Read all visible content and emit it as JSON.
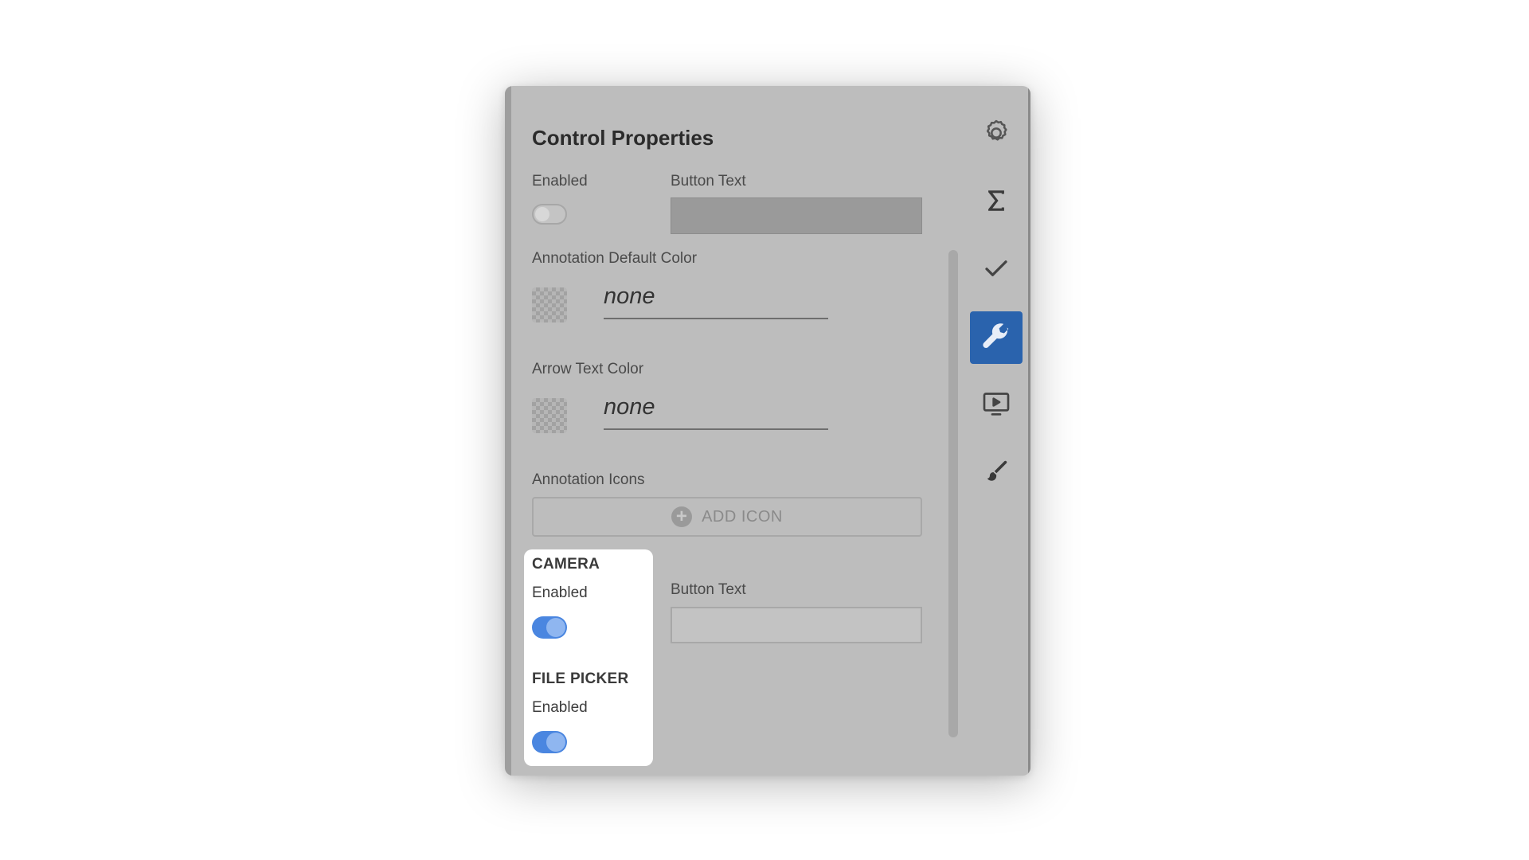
{
  "panel": {
    "title": "Control Properties",
    "enabled_label": "Enabled",
    "button_text_label": "Button Text",
    "annotation_default_color": {
      "label": "Annotation Default Color",
      "value": "none"
    },
    "arrow_text_color": {
      "label": "Arrow Text Color",
      "value": "none"
    },
    "annotation_icons_label": "Annotation Icons",
    "add_icon_label": "ADD ICON",
    "camera": {
      "heading": "CAMERA",
      "enabled_label": "Enabled",
      "enabled": true,
      "button_text_label": "Button Text"
    },
    "file_picker": {
      "heading": "FILE PICKER",
      "enabled_label": "Enabled",
      "enabled": true
    }
  },
  "nav": {
    "items": [
      {
        "icon": "gear-icon",
        "active": false
      },
      {
        "icon": "sigma-icon",
        "active": false
      },
      {
        "icon": "check-icon",
        "active": false
      },
      {
        "icon": "wrench-icon",
        "active": true
      },
      {
        "icon": "play-screen-icon",
        "active": false
      },
      {
        "icon": "brush-icon",
        "active": false
      }
    ]
  },
  "colors": {
    "accent": "#2a63ad",
    "toggle_on": "#4a86e0",
    "overlay_gray": "#bdbdbd"
  }
}
